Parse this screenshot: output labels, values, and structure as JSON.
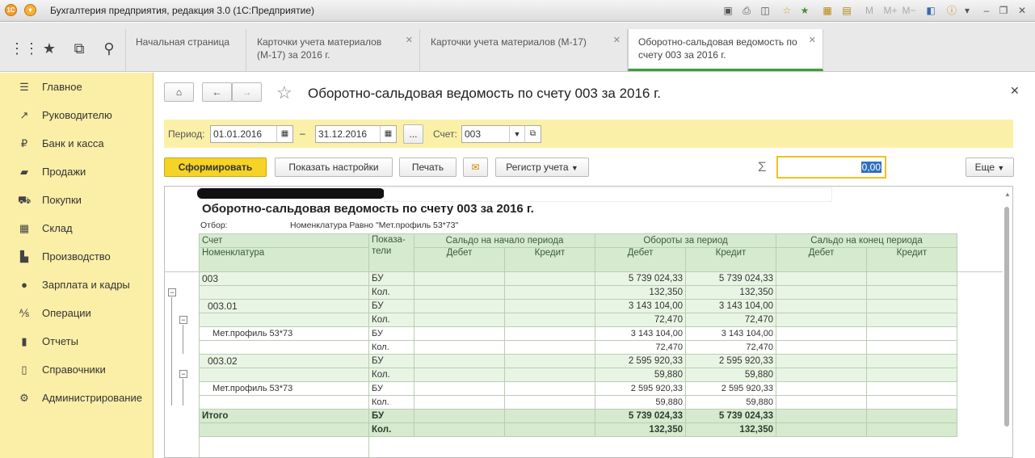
{
  "window": {
    "title": "Бухгалтерия предприятия, редакция 3.0 (1С:Предприятие)"
  },
  "tabs": [
    {
      "label": "Начальная страница"
    },
    {
      "label": "Карточки учета материалов (М-17) за 2016 г."
    },
    {
      "label": "Карточки учета материалов (М-17)"
    },
    {
      "label": "Оборотно-сальдовая ведомость по счету 003 за 2016 г."
    }
  ],
  "sidebar": {
    "items": [
      {
        "label": "Главное"
      },
      {
        "label": "Руководителю"
      },
      {
        "label": "Банк и касса"
      },
      {
        "label": "Продажи"
      },
      {
        "label": "Покупки"
      },
      {
        "label": "Склад"
      },
      {
        "label": "Производство"
      },
      {
        "label": "Зарплата и кадры"
      },
      {
        "label": "Операции"
      },
      {
        "label": "Отчеты"
      },
      {
        "label": "Справочники"
      },
      {
        "label": "Администрирование"
      }
    ]
  },
  "page": {
    "title": "Оборотно-сальдовая ведомость по счету 003 за 2016 г."
  },
  "filter": {
    "period_label": "Период:",
    "date_from": "01.01.2016",
    "dash": "–",
    "date_to": "31.12.2016",
    "more": "...",
    "account_label": "Счет:",
    "account": "003"
  },
  "toolbar": {
    "generate": "Сформировать",
    "show_settings": "Показать настройки",
    "print": "Печать",
    "register": "Регистр учета",
    "sum_value": "0,00",
    "more": "Еще"
  },
  "report": {
    "title": "Оборотно-сальдовая ведомость по счету 003 за 2016 г.",
    "filter_label": "Отбор:",
    "filter_value": "Номенклатура Равно \"Мет.профиль 53*73\"",
    "headers": {
      "account": "Счет",
      "nomenclature": "Номенклатура",
      "indicators": "Показа-\nтели",
      "opening": "Сальдо на начало периода",
      "turnover": "Обороты за период",
      "closing": "Сальдо на конец периода",
      "debit": "Дебет",
      "credit": "Кредит"
    },
    "rows": [
      {
        "name": "003",
        "ind": "БУ",
        "tdebit": "5 739 024,33",
        "tcredit": "5 739 024,33"
      },
      {
        "name": "",
        "ind": "Кол.",
        "tdebit": "132,350",
        "tcredit": "132,350"
      },
      {
        "name": "003.01",
        "ind": "БУ",
        "tdebit": "3 143 104,00",
        "tcredit": "3 143 104,00"
      },
      {
        "name": "",
        "ind": "Кол.",
        "tdebit": "72,470",
        "tcredit": "72,470"
      },
      {
        "name": "Мет.профиль 53*73",
        "ind": "БУ",
        "tdebit": "3 143 104,00",
        "tcredit": "3 143 104,00"
      },
      {
        "name": "",
        "ind": "Кол.",
        "tdebit": "72,470",
        "tcredit": "72,470"
      },
      {
        "name": "003.02",
        "ind": "БУ",
        "tdebit": "2 595 920,33",
        "tcredit": "2 595 920,33"
      },
      {
        "name": "",
        "ind": "Кол.",
        "tdebit": "59,880",
        "tcredit": "59,880"
      },
      {
        "name": "Мет.профиль 53*73",
        "ind": "БУ",
        "tdebit": "2 595 920,33",
        "tcredit": "2 595 920,33"
      },
      {
        "name": "",
        "ind": "Кол.",
        "tdebit": "59,880",
        "tcredit": "59,880"
      }
    ],
    "total": [
      {
        "name": "Итого",
        "ind": "БУ",
        "tdebit": "5 739 024,33",
        "tcredit": "5 739 024,33"
      },
      {
        "name": "",
        "ind": "Кол.",
        "tdebit": "132,350",
        "tcredit": "132,350"
      }
    ]
  },
  "colors": {
    "accent": "#f5d327",
    "sidebar": "#fbeea6",
    "table_header": "#d6ead0",
    "active_tab": "#3aa03a"
  }
}
